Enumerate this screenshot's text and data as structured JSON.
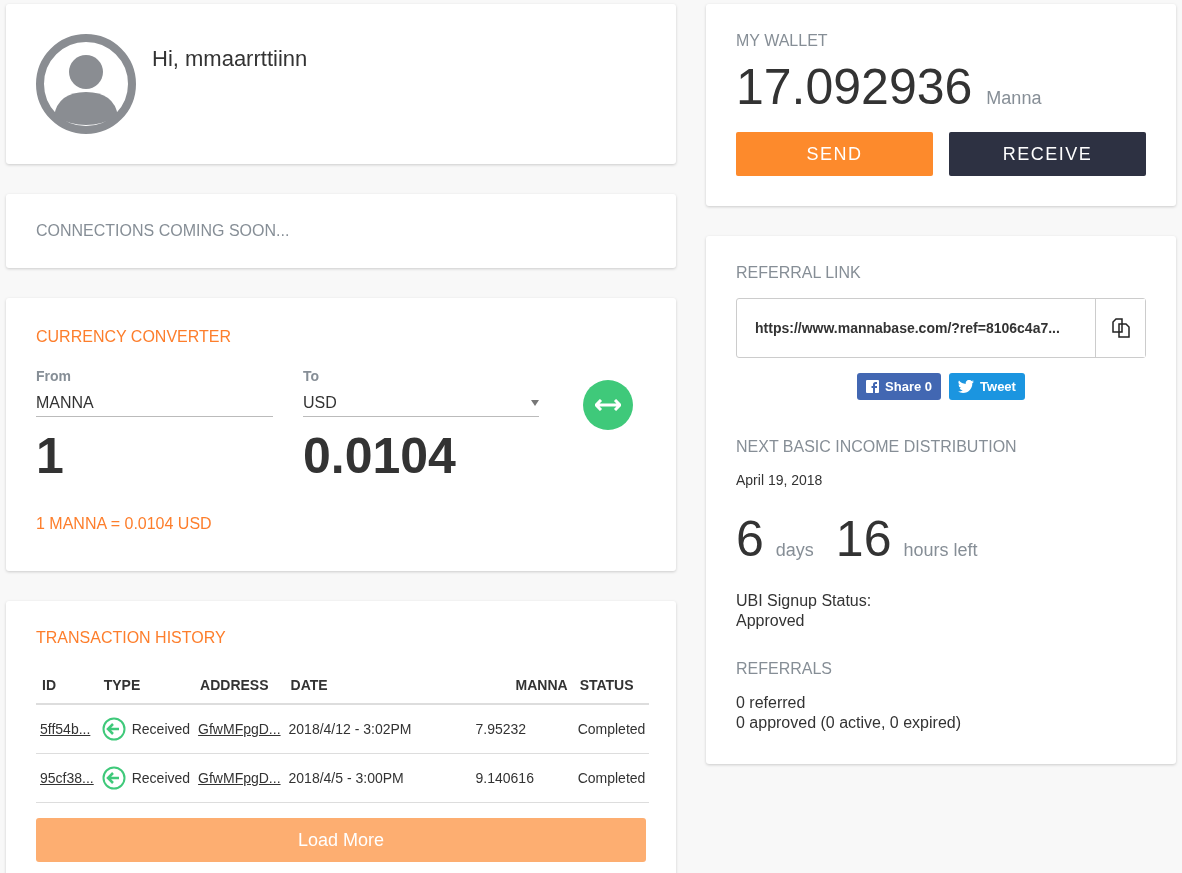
{
  "profile": {
    "greeting": "Hi, mmaarrttiinn"
  },
  "connections": {
    "text": "CONNECTIONS COMING SOON..."
  },
  "converter": {
    "title": "CURRENCY CONVERTER",
    "from_label": "From",
    "from_value": "MANNA",
    "to_label": "To",
    "to_value": "USD",
    "from_amount": "1",
    "to_amount": "0.0104",
    "rate": "1 MANNA = 0.0104 USD"
  },
  "transactions": {
    "title": "TRANSACTION HISTORY",
    "columns": [
      "ID",
      "TYPE",
      "ADDRESS",
      "DATE",
      "MANNA",
      "STATUS"
    ],
    "rows": [
      {
        "id": "5ff54b...",
        "type": "Received",
        "address": "GfwMFpgD...",
        "date": "2018/4/12 - 3:02PM",
        "manna": "7.95232",
        "status": "Completed"
      },
      {
        "id": "95cf38...",
        "type": "Received",
        "address": "GfwMFpgD...",
        "date": "2018/4/5 - 3:00PM",
        "manna": "9.140616",
        "status": "Completed"
      }
    ],
    "load_more": "Load More"
  },
  "wallet": {
    "title": "MY WALLET",
    "balance": "17.092936",
    "unit": "Manna",
    "send": "SEND",
    "receive": "RECEIVE"
  },
  "referral": {
    "title": "REFERRAL LINK",
    "link": "https://www.mannabase.com/?ref=8106c4a7...",
    "share": "Share 0",
    "tweet": "Tweet"
  },
  "distribution": {
    "title": "NEXT BASIC INCOME DISTRIBUTION",
    "date": "April 19, 2018",
    "days": "6",
    "days_label": "days",
    "hours": "16",
    "hours_label": "hours left",
    "status_label": "UBI Signup Status:",
    "status": "Approved"
  },
  "referrals": {
    "title": "REFERRALS",
    "referred": "0 referred",
    "approved": "0 approved (0 active, 0 expired)"
  }
}
